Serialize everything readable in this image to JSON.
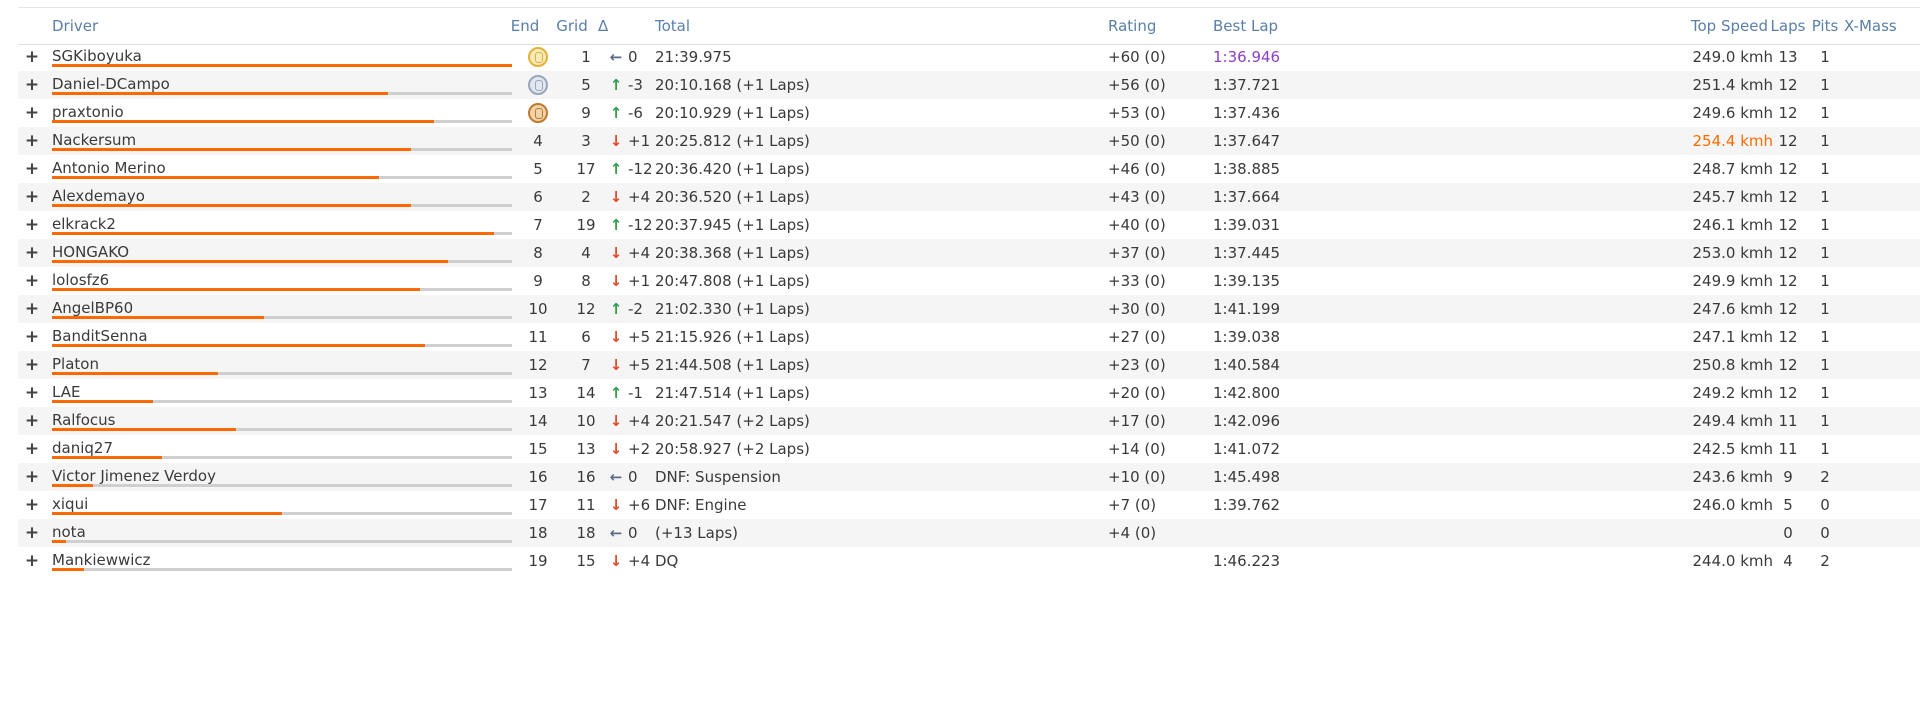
{
  "headers": {
    "driver": "Driver",
    "end": "End",
    "grid": "Grid",
    "delta": "Δ",
    "total": "Total",
    "rating": "Rating",
    "best_lap": "Best Lap",
    "top_speed": "Top Speed",
    "laps": "Laps",
    "pits": "Pits",
    "xmass": "X-Mass"
  },
  "colors": {
    "accent_bar": "#ff6a00",
    "best_lap_overall": "#8a3fc7",
    "top_speed_overall": "#ff6a00",
    "arrow_up": "#2e9e4a",
    "arrow_down": "#e04b2a"
  },
  "rows": [
    {
      "expand": "+",
      "driver": "SGKiboyuka",
      "bar": 1.0,
      "end": "",
      "medal": "gold-laurel-icon",
      "grid": "1",
      "delta_dir": "same",
      "delta": "0",
      "total": "21:39.975",
      "rating": "+60 (0)",
      "best": "1:36.946",
      "best_highlight": "purple",
      "top": "249.0 kmh",
      "top_highlight": "",
      "laps": "13",
      "pits": "1"
    },
    {
      "expand": "+",
      "driver": "Daniel-DCampo",
      "bar": 0.73,
      "end": "",
      "medal": "silver-laurel-icon",
      "grid": "5",
      "delta_dir": "up",
      "delta": "-3",
      "total": "20:10.168 (+1 Laps)",
      "rating": "+56 (0)",
      "best": "1:37.721",
      "best_highlight": "",
      "top": "251.4 kmh",
      "top_highlight": "",
      "laps": "12",
      "pits": "1"
    },
    {
      "expand": "+",
      "driver": "praxtonio",
      "bar": 0.83,
      "end": "",
      "medal": "bronze-laurel-icon",
      "grid": "9",
      "delta_dir": "up",
      "delta": "-6",
      "total": "20:10.929 (+1 Laps)",
      "rating": "+53 (0)",
      "best": "1:37.436",
      "best_highlight": "",
      "top": "249.6 kmh",
      "top_highlight": "",
      "laps": "12",
      "pits": "1"
    },
    {
      "expand": "+",
      "driver": "Nackersum",
      "bar": 0.78,
      "end": "4",
      "medal": "",
      "grid": "3",
      "delta_dir": "down",
      "delta": "+1",
      "total": "20:25.812 (+1 Laps)",
      "rating": "+50 (0)",
      "best": "1:37.647",
      "best_highlight": "",
      "top": "254.4 kmh",
      "top_highlight": "orange",
      "laps": "12",
      "pits": "1"
    },
    {
      "expand": "+",
      "driver": "Antonio Merino",
      "bar": 0.71,
      "end": "5",
      "medal": "",
      "grid": "17",
      "delta_dir": "up",
      "delta": "-12",
      "total": "20:36.420 (+1 Laps)",
      "rating": "+46 (0)",
      "best": "1:38.885",
      "best_highlight": "",
      "top": "248.7 kmh",
      "top_highlight": "",
      "laps": "12",
      "pits": "1"
    },
    {
      "expand": "+",
      "driver": "Alexdemayo",
      "bar": 0.78,
      "end": "6",
      "medal": "",
      "grid": "2",
      "delta_dir": "down",
      "delta": "+4",
      "total": "20:36.520 (+1 Laps)",
      "rating": "+43 (0)",
      "best": "1:37.664",
      "best_highlight": "",
      "top": "245.7 kmh",
      "top_highlight": "",
      "laps": "12",
      "pits": "1"
    },
    {
      "expand": "+",
      "driver": "elkrack2",
      "bar": 0.96,
      "end": "7",
      "medal": "",
      "grid": "19",
      "delta_dir": "up",
      "delta": "-12",
      "total": "20:37.945 (+1 Laps)",
      "rating": "+40 (0)",
      "best": "1:39.031",
      "best_highlight": "",
      "top": "246.1 kmh",
      "top_highlight": "",
      "laps": "12",
      "pits": "1"
    },
    {
      "expand": "+",
      "driver": "HONGAKO",
      "bar": 0.86,
      "end": "8",
      "medal": "",
      "grid": "4",
      "delta_dir": "down",
      "delta": "+4",
      "total": "20:38.368 (+1 Laps)",
      "rating": "+37 (0)",
      "best": "1:37.445",
      "best_highlight": "",
      "top": "253.0 kmh",
      "top_highlight": "",
      "laps": "12",
      "pits": "1"
    },
    {
      "expand": "+",
      "driver": "lolosfz6",
      "bar": 0.8,
      "end": "9",
      "medal": "",
      "grid": "8",
      "delta_dir": "down",
      "delta": "+1",
      "total": "20:47.808 (+1 Laps)",
      "rating": "+33 (0)",
      "best": "1:39.135",
      "best_highlight": "",
      "top": "249.9 kmh",
      "top_highlight": "",
      "laps": "12",
      "pits": "1"
    },
    {
      "expand": "+",
      "driver": "AngelBP60",
      "bar": 0.46,
      "end": "10",
      "medal": "",
      "grid": "12",
      "delta_dir": "up",
      "delta": "-2",
      "total": "21:02.330 (+1 Laps)",
      "rating": "+30 (0)",
      "best": "1:41.199",
      "best_highlight": "",
      "top": "247.6 kmh",
      "top_highlight": "",
      "laps": "12",
      "pits": "1"
    },
    {
      "expand": "+",
      "driver": "BanditSenna",
      "bar": 0.81,
      "end": "11",
      "medal": "",
      "grid": "6",
      "delta_dir": "down",
      "delta": "+5",
      "total": "21:15.926 (+1 Laps)",
      "rating": "+27 (0)",
      "best": "1:39.038",
      "best_highlight": "",
      "top": "247.1 kmh",
      "top_highlight": "",
      "laps": "12",
      "pits": "1"
    },
    {
      "expand": "+",
      "driver": "Platon",
      "bar": 0.36,
      "end": "12",
      "medal": "",
      "grid": "7",
      "delta_dir": "down",
      "delta": "+5",
      "total": "21:44.508 (+1 Laps)",
      "rating": "+23 (0)",
      "best": "1:40.584",
      "best_highlight": "",
      "top": "250.8 kmh",
      "top_highlight": "",
      "laps": "12",
      "pits": "1"
    },
    {
      "expand": "+",
      "driver": "LAE",
      "bar": 0.22,
      "end": "13",
      "medal": "",
      "grid": "14",
      "delta_dir": "up",
      "delta": "-1",
      "total": "21:47.514 (+1 Laps)",
      "rating": "+20 (0)",
      "best": "1:42.800",
      "best_highlight": "",
      "top": "249.2 kmh",
      "top_highlight": "",
      "laps": "12",
      "pits": "1"
    },
    {
      "expand": "+",
      "driver": "Ralfocus",
      "bar": 0.4,
      "end": "14",
      "medal": "",
      "grid": "10",
      "delta_dir": "down",
      "delta": "+4",
      "total": "20:21.547 (+2 Laps)",
      "rating": "+17 (0)",
      "best": "1:42.096",
      "best_highlight": "",
      "top": "249.4 kmh",
      "top_highlight": "",
      "laps": "11",
      "pits": "1"
    },
    {
      "expand": "+",
      "driver": "daniq27",
      "bar": 0.24,
      "end": "15",
      "medal": "",
      "grid": "13",
      "delta_dir": "down",
      "delta": "+2",
      "total": "20:58.927 (+2 Laps)",
      "rating": "+14 (0)",
      "best": "1:41.072",
      "best_highlight": "",
      "top": "242.5 kmh",
      "top_highlight": "",
      "laps": "11",
      "pits": "1"
    },
    {
      "expand": "+",
      "driver": "Victor Jimenez Verdoy",
      "bar": 0.09,
      "end": "16",
      "medal": "",
      "grid": "16",
      "delta_dir": "same",
      "delta": "0",
      "total": "DNF: Suspension",
      "rating": "+10 (0)",
      "best": "1:45.498",
      "best_highlight": "",
      "top": "243.6 kmh",
      "top_highlight": "",
      "laps": "9",
      "pits": "2"
    },
    {
      "expand": "+",
      "driver": "xiqui",
      "bar": 0.5,
      "end": "17",
      "medal": "",
      "grid": "11",
      "delta_dir": "down",
      "delta": "+6",
      "total": "DNF: Engine",
      "rating": "+7 (0)",
      "best": "1:39.762",
      "best_highlight": "",
      "top": "246.0 kmh",
      "top_highlight": "",
      "laps": "5",
      "pits": "0"
    },
    {
      "expand": "+",
      "driver": "nota",
      "bar": 0.03,
      "end": "18",
      "medal": "",
      "grid": "18",
      "delta_dir": "same",
      "delta": "0",
      "total": "(+13 Laps)",
      "rating": "+4 (0)",
      "best": "",
      "best_highlight": "",
      "top": "",
      "top_highlight": "",
      "laps": "0",
      "pits": "0"
    },
    {
      "expand": "+",
      "driver": "Mankiewwicz",
      "bar": 0.07,
      "end": "19",
      "medal": "",
      "grid": "15",
      "delta_dir": "down",
      "delta": "+4",
      "total": "DQ",
      "rating": "",
      "best": "1:46.223",
      "best_highlight": "",
      "top": "244.0 kmh",
      "top_highlight": "",
      "laps": "4",
      "pits": "2"
    }
  ]
}
